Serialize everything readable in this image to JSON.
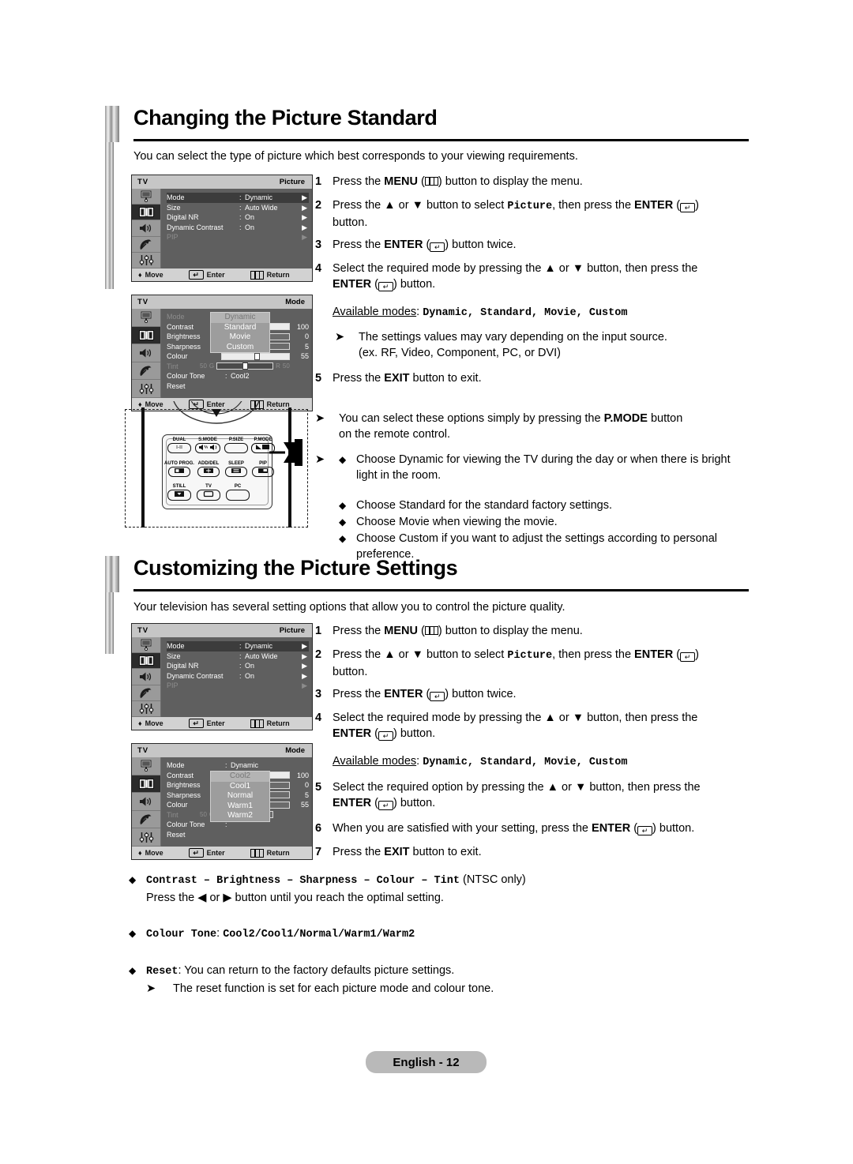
{
  "sections": [
    {
      "title": "Changing the Picture Standard",
      "intro": "You can select the type of picture which best corresponds to your viewing requirements.",
      "steps": [
        {
          "n": "1",
          "pre": "Press the ",
          "bold1": "MENU",
          "mid": " (",
          "icon": "menu-icon",
          "post": ") button to display the menu."
        },
        {
          "n": "2",
          "text": "Press the ▲ or ▼ button to select Picture, then press the ENTER (↵) button."
        },
        {
          "n": "3",
          "text": "Press the ENTER (↵) button twice."
        },
        {
          "n": "4",
          "text": "Select the required mode by pressing the ▲ or ▼ button, then press the ENTER (↵) button."
        },
        {
          "n": "5",
          "text": "Press the EXIT button to exit."
        }
      ],
      "available_label": "Available modes",
      "available_modes": "Dynamic, Standard, Movie, Custom",
      "notes": [
        "The settings values may vary depending on the input source.",
        "(ex. RF, Video, Component, PC, or DVI)",
        "You can select these options simply by pressing the P.MODE button",
        "on the remote control."
      ],
      "choice_bullets": [
        "Choose Dynamic for viewing the TV during the day or when there is bright light in the room.",
        "Choose Standard for the standard factory settings.",
        "Choose Movie when viewing the movie.",
        "Choose Custom if you want to adjust the settings according to personal preference."
      ]
    },
    {
      "title": "Customizing the Picture Settings",
      "intro": "Your television has several setting options that allow you to control the picture quality.",
      "available_label": "Available modes",
      "available_modes": "Dynamic, Standard, Movie, Custom"
    }
  ],
  "step_text": {
    "s1_pre": "Press the ",
    "s1_menu": "MENU",
    "s1_post": ") button to display the menu.",
    "s2_pre": "Press the ▲ or ▼ button to select ",
    "s2_mono": "Picture",
    "s2_mid": ", then press the ",
    "s2_enter": "ENTER",
    "s2_post": ") button.",
    "s2_line2": "button.",
    "s3_pre": "Press the ",
    "s3_enter": "ENTER",
    "s3_post": ") button twice.",
    "s4_pre": "Select the required mode by pressing the ▲ or ▼ button, then press the",
    "s4_line2_enter": "ENTER",
    "s4_line2_post": ") button.",
    "s5_mode_pre": "Press the ",
    "s5_exit": "EXIT",
    "s5_post": " button to exit.",
    "s5b_pre": "Select the required option by pressing the ▲ or ▼ button, then press the",
    "s6_pre": "When you are satisfied with your setting, press the ",
    "s6_enter": "ENTER",
    "s6_post": ") button.",
    "s7_pre": "Press the ",
    "s7_exit": "EXIT",
    "s7_post": " button to exit."
  },
  "note_pmode": {
    "pre": "You can select these options simply by pressing the ",
    "bold": "P.MODE",
    "post": " button",
    "line2": "on the remote control."
  },
  "note_settings": {
    "line1": "The settings values may vary depending on the input source.",
    "line2": "(ex. RF, Video, Component, PC, or DVI)"
  },
  "bottom_bullets": [
    {
      "mono": "Contrast – Brightness – Sharpness – Colour – Tint",
      "plain": " (NTSC only)",
      "sub": "Press the ◀ or ▶ button until you reach the optimal setting."
    },
    {
      "mono": "Colour Tone",
      "plain": ": ",
      "mono2": "Cool2/Cool1/Normal/Warm1/Warm2"
    },
    {
      "mono": "Reset",
      "plain": ": You can return to the factory defaults picture settings.",
      "sub_arrow": "The reset function is set for each picture mode and colour tone."
    }
  ],
  "osd": {
    "tv_label": "TV",
    "picture_title": "Picture",
    "mode_title": "Mode",
    "footer": {
      "move": "Move",
      "enter": "Enter",
      "return": "Return"
    },
    "rail_icons": [
      "monitor-icon",
      "picture-icon",
      "speaker-icon",
      "satellite-icon",
      "setup-icon"
    ],
    "picture_rows": [
      {
        "label": "Mode",
        "value": "Dynamic",
        "selected": true,
        "dim": false
      },
      {
        "label": "Size",
        "value": "Auto Wide",
        "selected": false,
        "dim": false
      },
      {
        "label": "Digital NR",
        "value": "On",
        "selected": false,
        "dim": false
      },
      {
        "label": "Dynamic Contrast",
        "value": "On",
        "selected": false,
        "dim": false
      },
      {
        "label": "PIP",
        "value": "",
        "selected": false,
        "dim": true
      }
    ],
    "mode_rows": [
      {
        "label": "Mode",
        "type": "value",
        "value": "Dynamic"
      },
      {
        "label": "Contrast",
        "type": "slider",
        "num": "100",
        "pct": 100
      },
      {
        "label": "Brightness",
        "type": "slider",
        "num": "0",
        "pct": 12
      },
      {
        "label": "Sharpness",
        "type": "slider",
        "num": "5",
        "pct": 12
      },
      {
        "label": "Colour",
        "type": "slider",
        "num": "55",
        "pct": 52
      },
      {
        "label": "Tint",
        "type": "tint",
        "left": "50",
        "g": "G",
        "r": "R",
        "right": "50",
        "dim": true
      },
      {
        "label": "Colour Tone",
        "type": "value",
        "value": "Cool2"
      },
      {
        "label": "Reset",
        "type": "plain",
        "value": ""
      }
    ],
    "mode_popup": [
      "Dynamic",
      "Standard",
      "Movie",
      "Custom"
    ],
    "tone_popup": [
      "Cool2",
      "Cool1",
      "Normal",
      "Warm1",
      "Warm2"
    ]
  },
  "remote": {
    "rows": [
      [
        {
          "label": "DUAL",
          "glyph": "I-II"
        },
        {
          "label": "S.MODE",
          "glyph": "sound-mode-icon"
        },
        {
          "label": "P.SIZE",
          "glyph": ""
        },
        {
          "label": "P.MODE",
          "glyph": "picture-mode-icon"
        }
      ],
      [
        {
          "label": "AUTO PROG.",
          "glyph": "auto-prog-icon"
        },
        {
          "label": "ADD/DEL",
          "glyph": "add-del-icon"
        },
        {
          "label": "SLEEP",
          "glyph": "sleep-icon"
        },
        {
          "label": "PIP",
          "glyph": "pip-icon"
        }
      ],
      [
        {
          "label": "STILL",
          "glyph": "still-icon"
        },
        {
          "label": "TV",
          "glyph": "tv-icon"
        },
        {
          "label": "PC",
          "glyph": ""
        }
      ]
    ]
  },
  "footer": {
    "page_label": "English - 12"
  },
  "colors": {
    "osd_bg": "#5f5f5f",
    "osd_rail": "#9a9a9a",
    "osd_header": "#c6c6c6",
    "footer_pill": "#b9b9b9"
  }
}
